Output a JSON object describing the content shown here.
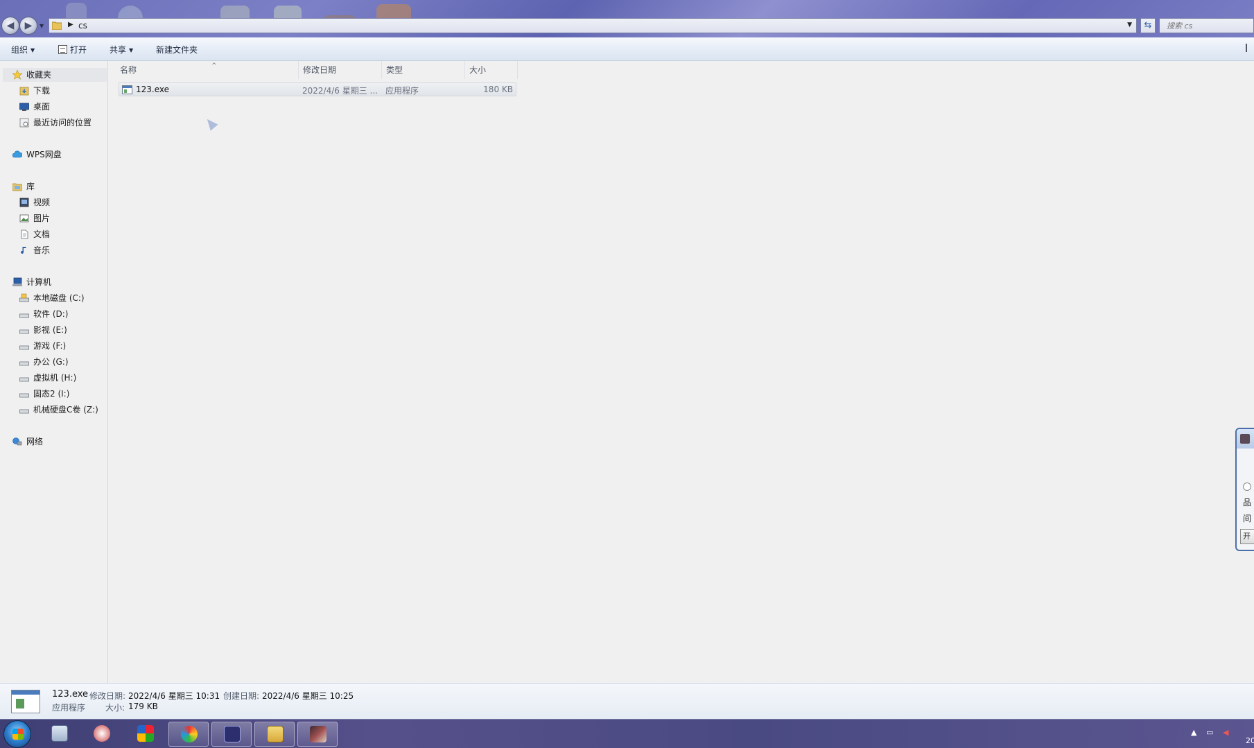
{
  "address": {
    "path": [
      "cs"
    ],
    "search_placeholder": "搜索 cs"
  },
  "toolbar": {
    "organize": "组织",
    "open": "打开",
    "share": "共享",
    "new_folder": "新建文件夹"
  },
  "nav": {
    "favorites": "收藏夹",
    "fav_items": [
      "下载",
      "桌面",
      "最近访问的位置"
    ],
    "wps": "WPS网盘",
    "library": "库",
    "lib_items": [
      "视频",
      "图片",
      "文档",
      "音乐"
    ],
    "computer": "计算机",
    "drives": [
      "本地磁盘 (C:)",
      "软件 (D:)",
      "影视 (E:)",
      "游戏 (F:)",
      "办公 (G:)",
      "虚拟机 (H:)",
      "固态2 (I:)",
      "机械硬盘C卷 (Z:)"
    ],
    "network": "网络"
  },
  "columns": [
    "名称",
    "修改日期",
    "类型",
    "大小"
  ],
  "files": [
    {
      "name": "123.exe",
      "modified": "2022/4/6 星期三 ...",
      "type": "应用程序",
      "size": "180 KB"
    }
  ],
  "details": {
    "name": "123.exe",
    "modified_label": "修改日期:",
    "modified_value": "2022/4/6 星期三 10:31",
    "created_label": "创建日期:",
    "created_value": "2022/4/6 星期三 10:25",
    "type": "应用程序",
    "size_label": "大小:",
    "size_value": "179 KB"
  },
  "side_panel": {
    "line1": "品",
    "line2": "间",
    "button": "开"
  },
  "tray": {
    "clock_fragment": "20"
  }
}
